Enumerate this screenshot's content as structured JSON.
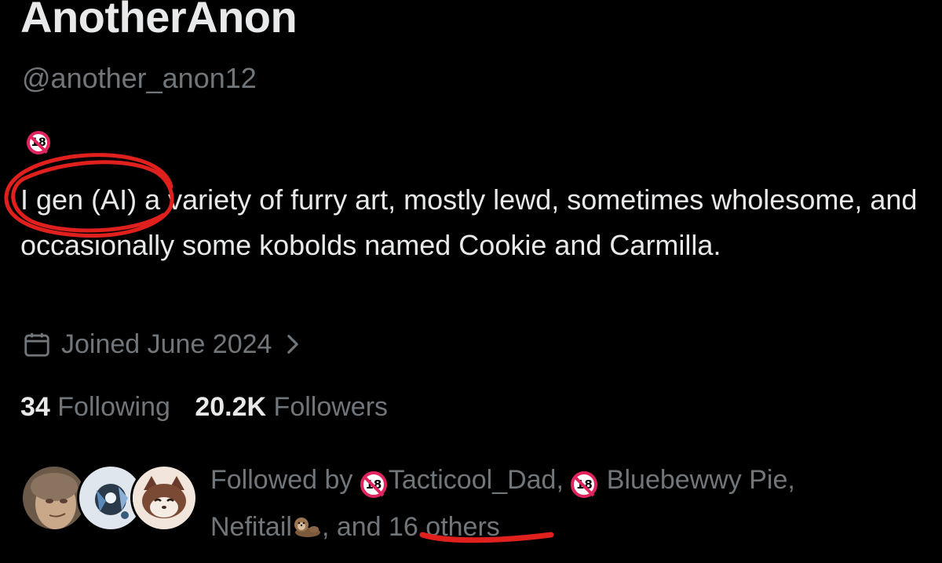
{
  "profile": {
    "display_name": "AnotherAnon",
    "handle": "@another_anon12",
    "bio_badge_text": "18",
    "bio": "I gen (AI) a variety of furry art, mostly lewd, sometimes wholesome, and occasionally some kobolds named Cookie and Carmilla.",
    "joined": "Joined June 2024",
    "following_count": "34",
    "following_label": "Following",
    "followers_count": "20.2K",
    "followers_label": "Followers"
  },
  "followed_by": {
    "prefix": "Followed by",
    "badge_text": "18",
    "user1": "Tacticool_Dad,",
    "user2": "Bluebewwy Pie,",
    "user3": "Nefitail",
    "sep": ", and",
    "others": "16 others"
  },
  "icons": {
    "nsfw": "no-under-18-icon",
    "calendar": "calendar-icon",
    "chevron": "chevron-right-icon",
    "otter": "otter-emoji-icon"
  },
  "colors": {
    "background": "#000000",
    "primary_text": "#e7e9ea",
    "secondary_text": "#71767b",
    "annotation": "#e0201c",
    "badge_ring": "#e0245e"
  }
}
